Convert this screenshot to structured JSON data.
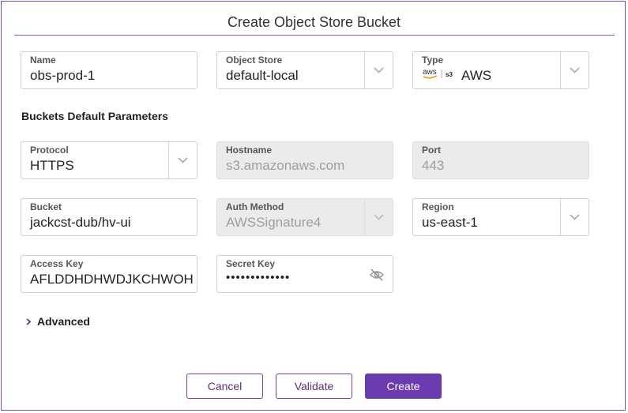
{
  "dialog": {
    "title": "Create Object Store Bucket"
  },
  "fields": {
    "name": {
      "label": "Name",
      "value": "obs-prod-1"
    },
    "object_store": {
      "label": "Object Store",
      "value": "default-local"
    },
    "type": {
      "label": "Type",
      "value": "AWS",
      "icon": "aws-s3-logo-icon",
      "logo_text": "aws",
      "s3_text": "s3"
    },
    "protocol": {
      "label": "Protocol",
      "value": "HTTPS"
    },
    "hostname": {
      "label": "Hostname",
      "value": "s3.amazonaws.com"
    },
    "port": {
      "label": "Port",
      "value": "443"
    },
    "bucket": {
      "label": "Bucket",
      "value": "jackcst-dub/hv-ui"
    },
    "auth_method": {
      "label": "Auth Method",
      "value": "AWSSignature4"
    },
    "region": {
      "label": "Region",
      "value": "us-east-1"
    },
    "access_key": {
      "label": "Access Key",
      "value": "AFLDDHDHWDJKCHWOH"
    },
    "secret_key": {
      "label": "Secret Key",
      "value": "•••••••••••••",
      "icon": "eye-off-icon"
    }
  },
  "sections": {
    "defaults_title": "Buckets Default Parameters",
    "advanced_label": "Advanced"
  },
  "buttons": {
    "cancel": "Cancel",
    "validate": "Validate",
    "create": "Create"
  },
  "colors": {
    "accent": "#6b3bb0",
    "border_accent": "#7a4fa8",
    "aws_orange": "#f29100"
  }
}
